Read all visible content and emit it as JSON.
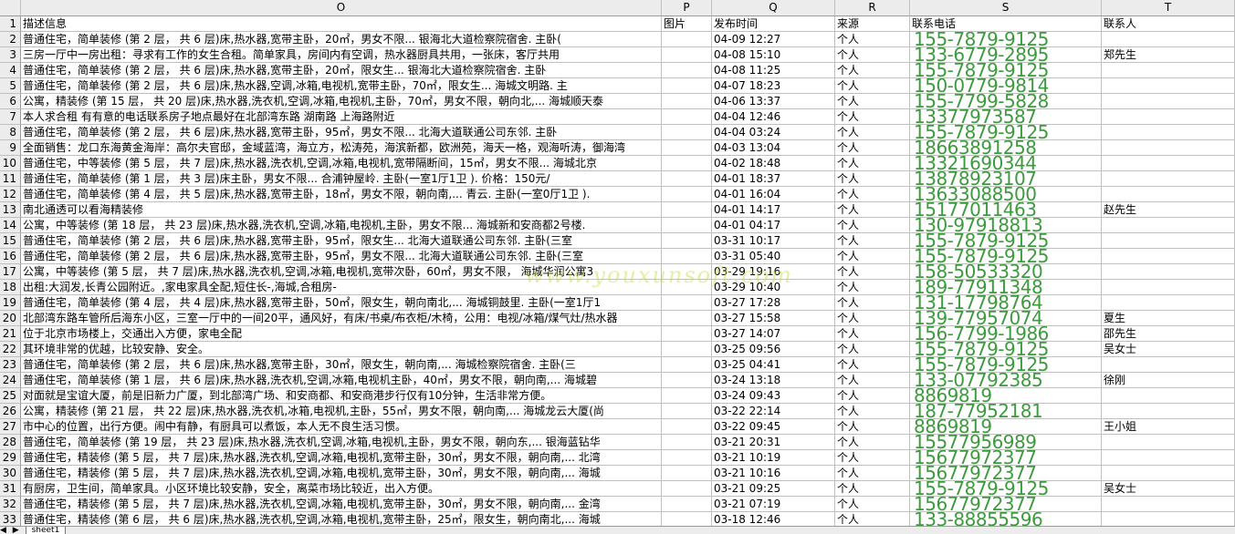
{
  "columns": {
    "row_corner": "",
    "O": "O",
    "P": "P",
    "Q": "Q",
    "R": "R",
    "S": "S",
    "T": "T"
  },
  "header_row": {
    "num": "1",
    "desc": "描述信息",
    "pic": "图片",
    "time": "发布时间",
    "source": "来源",
    "phone": "联系电话",
    "contact": "联系人"
  },
  "rows": [
    {
      "num": "2",
      "desc": "普通住宅，简单装修 (第 2 层， 共 6 层)床,热水器,宽带主卧，20㎡，男女不限...        银海北大道检察院宿舍.        主卧(",
      "time": "04-09 12:27",
      "source": "个人",
      "phone": "155-7879-9125",
      "contact": ""
    },
    {
      "num": "3",
      "desc": "三房一厅中一房出租：寻求有工作的女生合租。简单家具，房间内有空调，热水器厨具共用，一张床，客厅共用",
      "time": "04-08 15:10",
      "source": "个人",
      "phone": "133-6779-2895",
      "contact": "郑先生"
    },
    {
      "num": "4",
      "desc": "普通住宅，简单装修 (第 2 层， 共 6 层)床,热水器,宽带主卧，20㎡，限女生...        银海北大道检察院宿舍.        主卧",
      "time": "04-08 11:25",
      "source": "个人",
      "phone": "155-7879-9125",
      "contact": ""
    },
    {
      "num": "5",
      "desc": "普通住宅，简单装修 (第 2 层， 共 6 层)床,热水器,空调,冰箱,电视机,宽带主卧，70㎡，限女生...        海城文明路.        主",
      "time": "04-07 18:23",
      "source": "个人",
      "phone": "150-0779-9814",
      "contact": ""
    },
    {
      "num": "6",
      "desc": "公寓，精装修 (第 15 层， 共 20 层)床,热水器,洗衣机,空调,冰箱,电视机,主卧，70㎡，男女不限，朝向北,...        海城顺天泰",
      "time": "04-06 13:37",
      "source": "个人",
      "phone": "155-7799-5828",
      "contact": ""
    },
    {
      "num": "7",
      "desc": "本人求合租 有有意的电话联系房子地点最好在北部湾东路 湖南路 上海路附近",
      "time": "04-04 12:46",
      "source": "个人",
      "phone": "13377973587",
      "contact": ""
    },
    {
      "num": "8",
      "desc": "普通住宅，简单装修 (第 2 层， 共 6 层)床,热水器,宽带主卧，95㎡，男女不限...        北海大道联通公司东邻.        主卧",
      "time": "04-04 03:24",
      "source": "个人",
      "phone": "155-7879-9125",
      "contact": ""
    },
    {
      "num": "9",
      "desc": "全面销售：龙口东海黄金海岸：高尔夫官邸，金域蓝湾，海立方，松涛苑，海滨新都，欧洲苑，海天一格，观海听涛，御海湾",
      "time": "04-03 13:04",
      "source": "个人",
      "phone": "18663891258",
      "contact": ""
    },
    {
      "num": "10",
      "desc": "普通住宅，中等装修 (第 5 层， 共 7 层)床,热水器,洗衣机,空调,冰箱,电视机,宽带隔断间，15㎡，男女不限...        海城北京",
      "time": "04-02 18:48",
      "source": "个人",
      "phone": "13321690344",
      "contact": ""
    },
    {
      "num": "11",
      "desc": "普通住宅，简单装修 (第 1 层， 共 3 层)床主卧，男女不限...        合浦钟屋岭.        主卧(一室1厅1卫 ).        价格：150元/",
      "time": "04-01 18:37",
      "source": "个人",
      "phone": "13878923107",
      "contact": ""
    },
    {
      "num": "12",
      "desc": "普通住宅，简单装修 (第 4 层， 共 5 层)床,热水器,宽带主卧，18㎡，男女不限，朝向南,...        青云.        主卧(一室0厅1卫 ).",
      "time": "04-01 16:04",
      "source": "个人",
      "phone": "13633088500",
      "contact": ""
    },
    {
      "num": "13",
      "desc": "南北通透可以看海精装修",
      "time": "04-01 14:17",
      "source": "个人",
      "phone": "15177011463",
      "contact": "赵先生"
    },
    {
      "num": "14",
      "desc": "公寓，中等装修 (第 18 层， 共 23 层)床,热水器,洗衣机,空调,冰箱,电视机,主卧，男女不限...        海城新和安商都2号楼.",
      "time": "04-01 04:17",
      "source": "个人",
      "phone": "130-97918813",
      "contact": ""
    },
    {
      "num": "15",
      "desc": "普通住宅，简单装修 (第 2 层， 共 6 层)床,热水器,宽带主卧，95㎡，限女生...        北海大道联通公司东邻.        主卧(三室",
      "time": "03-31 10:17",
      "source": "个人",
      "phone": "155-7879-9125",
      "contact": ""
    },
    {
      "num": "16",
      "desc": "普通住宅，简单装修 (第 2 层， 共 6 层)床,热水器,宽带主卧，95㎡，男女不限...        北海大道联通公司东邻.        主卧(三室",
      "time": "03-31 05:40",
      "source": "个人",
      "phone": "155-7879-9125",
      "contact": ""
    },
    {
      "num": "17",
      "desc": "公寓，中等装修 (第 5 层， 共 7 层)床,热水器,洗衣机,空调,冰箱,电视机,宽带次卧，60㎡，男女不限，        海城华润公寓3",
      "time": "03-29 19:16",
      "source": "个人",
      "phone": "158-50533320",
      "contact": ""
    },
    {
      "num": "18",
      "desc": "出租:大润发,长青公园附近。,家电家具全配,短住长-,海城,合租房-",
      "time": "03-29 10:40",
      "source": "个人",
      "phone": "189-77911348",
      "contact": ""
    },
    {
      "num": "19",
      "desc": "普通住宅，简单装修 (第 4 层， 共 4 层)床,热水器,宽带主卧，50㎡，限女生，朝向南北,...        海城铜鼓里.        主卧(一室1厅1",
      "time": "03-27 17:28",
      "source": "个人",
      "phone": "131-17798764",
      "contact": ""
    },
    {
      "num": "20",
      "desc": "北部湾东路车管所后海东小区，三室一厅中的一间20平，通风好，有床/书桌/布衣柜/木椅，公用：电视/冰箱/煤气灶/热水器",
      "time": "03-27 15:58",
      "source": "个人",
      "phone": "139-77957074",
      "contact": "夏生"
    },
    {
      "num": "21",
      "desc": "位于北京市场楼上，交通出入方便，家电全配",
      "time": "03-27 14:07",
      "source": "个人",
      "phone": "156-7799-1986",
      "contact": "邵先生"
    },
    {
      "num": "22",
      "desc": "其环境非常的优越，比较安静、安全。",
      "time": "03-25 09:56",
      "source": "个人",
      "phone": "155-7879-9125",
      "contact": "吴女士"
    },
    {
      "num": "23",
      "desc": "普通住宅，简单装修 (第 2 层， 共 6 层)床,热水器,宽带主卧，30㎡，限女生，朝向南,...        海城检察院宿舍.        主卧(三",
      "time": "03-25 04:41",
      "source": "个人",
      "phone": "155-7879-9125",
      "contact": ""
    },
    {
      "num": "24",
      "desc": "普通住宅，简单装修 (第 1 层， 共 6 层)床,热水器,洗衣机,空调,冰箱,电视机主卧，40㎡，男女不限，朝向南,...        海城碧",
      "time": "03-24 13:18",
      "source": "个人",
      "phone": "133-07792385",
      "contact": "徐刚"
    },
    {
      "num": "25",
      "desc": "对面就是宝谊大厦，前是旧新力广厦，到北部湾广场、和安商都、和安商港步行仅有10分钟，生活非常方便。",
      "time": "03-24 09:43",
      "source": "个人",
      "phone": "8869819",
      "contact": ""
    },
    {
      "num": "26",
      "desc": "公寓，精装修 (第 21 层， 共 22 层)床,热水器,洗衣机,冰箱,电视机,主卧，55㎡，男女不限，朝向南,...        海城龙云大厦(尚",
      "time": "03-22 22:14",
      "source": "个人",
      "phone": "187-77952181",
      "contact": ""
    },
    {
      "num": "27",
      "desc": "市中心的位置，出行方便。闹中有静，有厨具可以煮饭，本人无不良生活习惯。",
      "time": "03-22 09:45",
      "source": "个人",
      "phone": "8869819",
      "contact": "王小姐"
    },
    {
      "num": "28",
      "desc": "普通住宅，简单装修 (第 19 层， 共 23 层)床,热水器,洗衣机,空调,冰箱,电视机,主卧，男女不限，朝向东,...        银海蓝钻华",
      "time": "03-21 20:31",
      "source": "个人",
      "phone": "15577956989",
      "contact": ""
    },
    {
      "num": "29",
      "desc": "普通住宅，精装修 (第 5 层， 共 7 层)床,热水器,洗衣机,空调,冰箱,电视机,宽带主卧，30㎡，男女不限，朝向南,...        北湾",
      "time": "03-21 10:19",
      "source": "个人",
      "phone": "15677972377",
      "contact": ""
    },
    {
      "num": "30",
      "desc": "普通住宅，精装修 (第 5 层， 共 7 层)床,热水器,洗衣机,空调,冰箱,电视机,宽带主卧，30㎡，男女不限，朝向南,...        海城",
      "time": "03-21 10:16",
      "source": "个人",
      "phone": "15677972377",
      "contact": ""
    },
    {
      "num": "31",
      "desc": "有厨房，卫生间，简单家具。小区环境比较安静，安全，离菜市场比较近，出入方便。",
      "time": "03-21 09:25",
      "source": "个人",
      "phone": "155-7879-9125",
      "contact": "吴女士"
    },
    {
      "num": "32",
      "desc": "普通住宅，精装修 (第 5 层， 共 7 层)床,热水器,洗衣机,空调,冰箱,电视机,宽带主卧，30㎡，男女不限，朝向南,...        金湾",
      "time": "03-21 07:19",
      "source": "个人",
      "phone": "15677972377",
      "contact": ""
    },
    {
      "num": "33",
      "desc": "普通住宅，精装修 (第 6 层， 共 6 层)床,热水器,洗衣机,空调,冰箱,电视机,宽带主卧，25㎡，限女生，朝向南北,...        海城",
      "time": "03-18 12:46",
      "source": "个人",
      "phone": "133-88855596",
      "contact": ""
    }
  ],
  "watermark": "www.youxunsoft.com",
  "sheet_tab": "sheet1",
  "nav_arrows": [
    "◀",
    "▶"
  ],
  "colors": {
    "phone": "#3c9b3c",
    "header_bg": "#ececec",
    "grid": "#c0c0c0"
  }
}
